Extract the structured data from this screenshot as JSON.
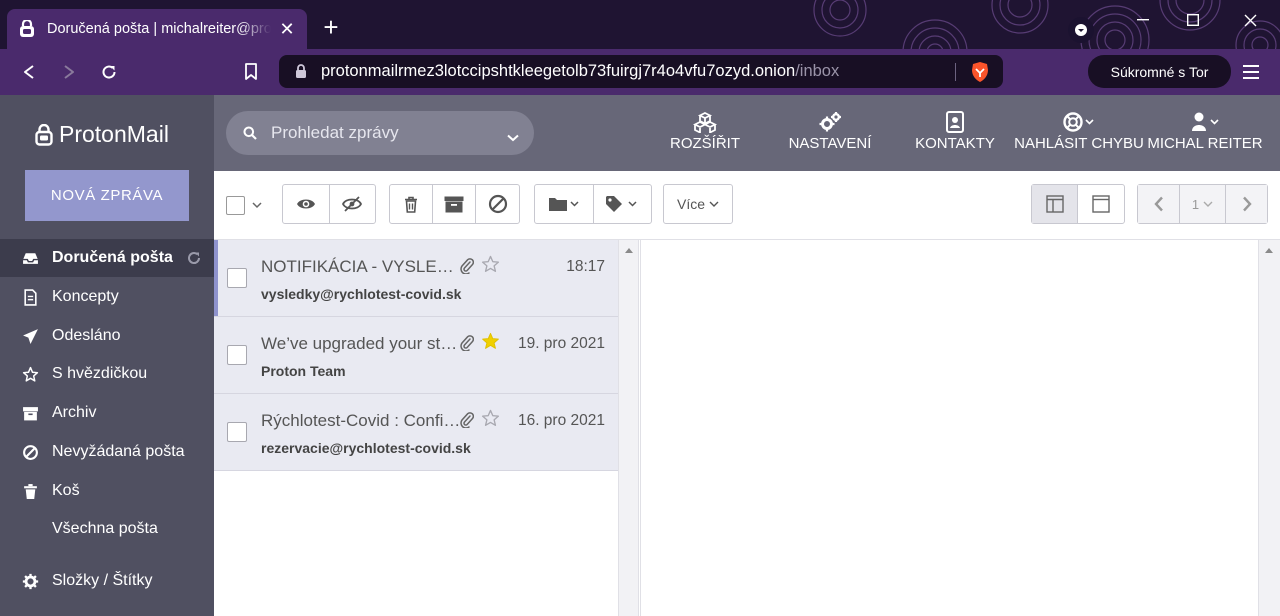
{
  "browser": {
    "tab_title": "Doručená pošta | michalreiter@protonmail.com",
    "url_host": "protonmailrmez3lotccipshtkleegetolb73fuirgj7r4o4vfu7ozyd.onion",
    "url_path": "/inbox",
    "tor_button": "Súkromné s Tor"
  },
  "app": {
    "logo_text": "ProtonMail",
    "compose_label": "NOVÁ ZPRÁVA",
    "search_placeholder": "Prohledat zprávy",
    "header_nav": [
      {
        "label": "ROZŠÍŘIT",
        "icon": "cubes-icon"
      },
      {
        "label": "NASTAVENÍ",
        "icon": "gears-icon"
      },
      {
        "label": "KONTAKTY",
        "icon": "contacts-icon"
      },
      {
        "label": "NAHLÁSIT CHYBU",
        "icon": "lifebuoy-icon"
      },
      {
        "label": "MICHAL REITER",
        "icon": "user-icon"
      }
    ]
  },
  "sidebar": {
    "items": [
      {
        "label": "Doručená pošta",
        "icon": "inbox-icon",
        "active": true
      },
      {
        "label": "Koncepty",
        "icon": "draft-icon"
      },
      {
        "label": "Odesláno",
        "icon": "paper-plane-icon"
      },
      {
        "label": "S hvězdičkou",
        "icon": "star-icon"
      },
      {
        "label": "Archiv",
        "icon": "archive-icon"
      },
      {
        "label": "Nevyžádaná pošta",
        "icon": "ban-icon"
      },
      {
        "label": "Koš",
        "icon": "trash-icon"
      },
      {
        "label": "Všechna pošta",
        "icon": ""
      },
      {
        "label": "Složky / Štítky",
        "icon": "gear-icon"
      }
    ]
  },
  "toolbar": {
    "more_label": "Více",
    "page_number": "1"
  },
  "messages": [
    {
      "subject": "NOTIFIKÁCIA - VYSLEDOK TESTU",
      "from": "vysledky@rychlotest-covid.sk",
      "date": "18:17",
      "starred": false
    },
    {
      "subject": "We’ve upgraded your storage",
      "from": "Proton Team",
      "date": "19. pro 2021",
      "starred": true
    },
    {
      "subject": "Rýchlotest-Covid : Confirmation",
      "from": "rezervacie@rychlotest-covid.sk",
      "date": "16. pro 2021",
      "starred": false
    }
  ],
  "colors": {
    "sidebar_bg": "#505061",
    "header_bg": "#676778",
    "compose_bg": "#9397cd",
    "star_active": "#f0d000",
    "browser_accent": "#4a2a6c"
  }
}
